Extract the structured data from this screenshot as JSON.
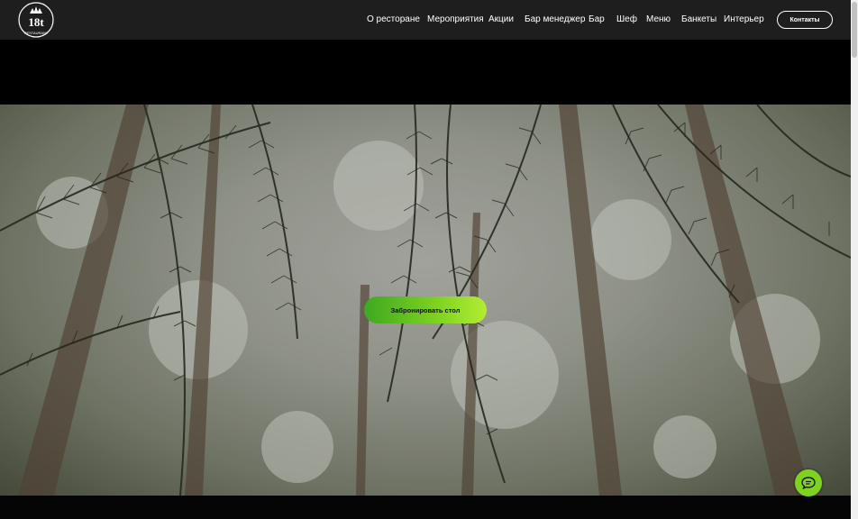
{
  "header": {
    "logo": {
      "text_top": "18t",
      "text_ring": "RESTAURANT"
    },
    "nav_items": [
      {
        "label": "О ресторане"
      },
      {
        "label": "Мероприятия"
      },
      {
        "label": "Акции"
      },
      {
        "label": "Бар менеджер"
      },
      {
        "label": "Бар"
      },
      {
        "label": "Шеф"
      },
      {
        "label": "Меню"
      },
      {
        "label": "Банкеты"
      },
      {
        "label": "Интерьер"
      }
    ],
    "contact_label": "Контакты"
  },
  "hero": {
    "book_button_label": "Забронировать стол"
  },
  "colors": {
    "accent_green": "#7ed321",
    "header_bg": "#1e1e1e"
  },
  "icons": {
    "chat": "chat-bubble-icon",
    "logo": "restaurant-logo-icon"
  }
}
